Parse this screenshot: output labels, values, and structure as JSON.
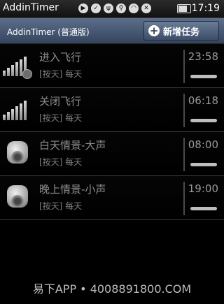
{
  "status_bar": {
    "app_name": "AddinTimer",
    "time": "17:19"
  },
  "header": {
    "title": "AddinTimer (普通版)",
    "add_task_label": "新增任务"
  },
  "tasks": [
    {
      "name": "进入飞行",
      "schedule": "[按天] 每天",
      "time": "23:58",
      "icon": "signal-bars-icon"
    },
    {
      "name": "关闭飞行",
      "schedule": "[按天] 每天",
      "time": "06:18",
      "icon": "signal-bars-icon"
    },
    {
      "name": "白天情景-大声",
      "schedule": "[按天] 每天",
      "time": "08:00",
      "icon": "speaker-icon"
    },
    {
      "name": "晚上情景-小声",
      "schedule": "[按天] 每天",
      "time": "19:00",
      "icon": "speaker-icon"
    }
  ],
  "watermark": "易下APP • 4008891800.COM"
}
